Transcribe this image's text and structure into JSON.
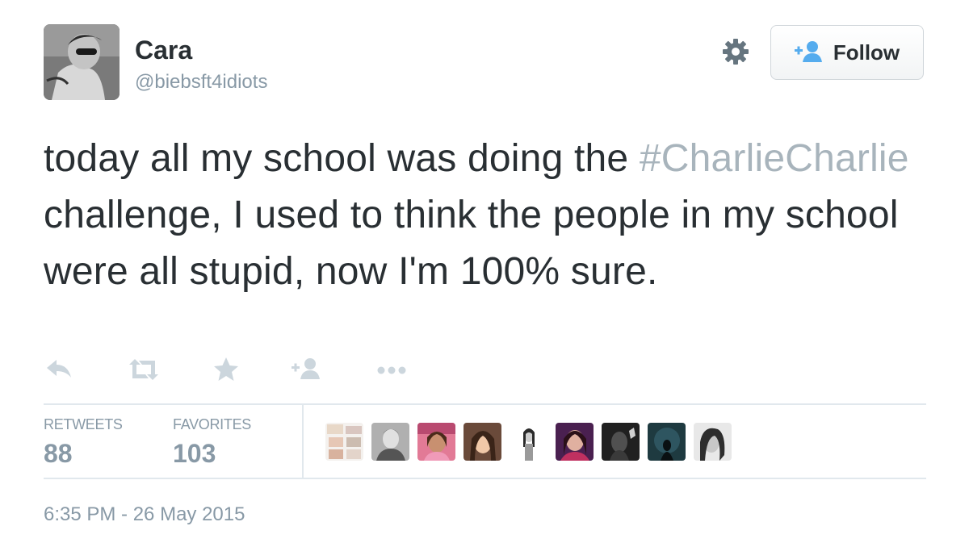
{
  "tweet": {
    "author": {
      "name": "Cara",
      "handle": "@biebsft4idiots"
    },
    "follow_label": "Follow",
    "text": {
      "part1": "today all my school was doing the ",
      "hashtag": "#CharlieCharlie",
      "part2": " challenge, I used to think the people in my school were all stupid, now I'm 100% sure."
    },
    "actions": [
      "reply-icon",
      "retweet-icon",
      "favorite-icon",
      "follow-icon",
      "more-icon"
    ],
    "stats": {
      "retweets_label": "RETWEETS",
      "retweets_value": "88",
      "favorites_label": "FAVORITES",
      "favorites_value": "103"
    },
    "timestamp": "6:35 PM - 26 May 2015"
  },
  "colors": {
    "text": "#292f33",
    "muted": "#8899a6",
    "hashtag": "#a8b4bc",
    "follow_icon": "#55acee",
    "action_icon": "#ccd6dd",
    "divider": "#e1e8ed"
  }
}
